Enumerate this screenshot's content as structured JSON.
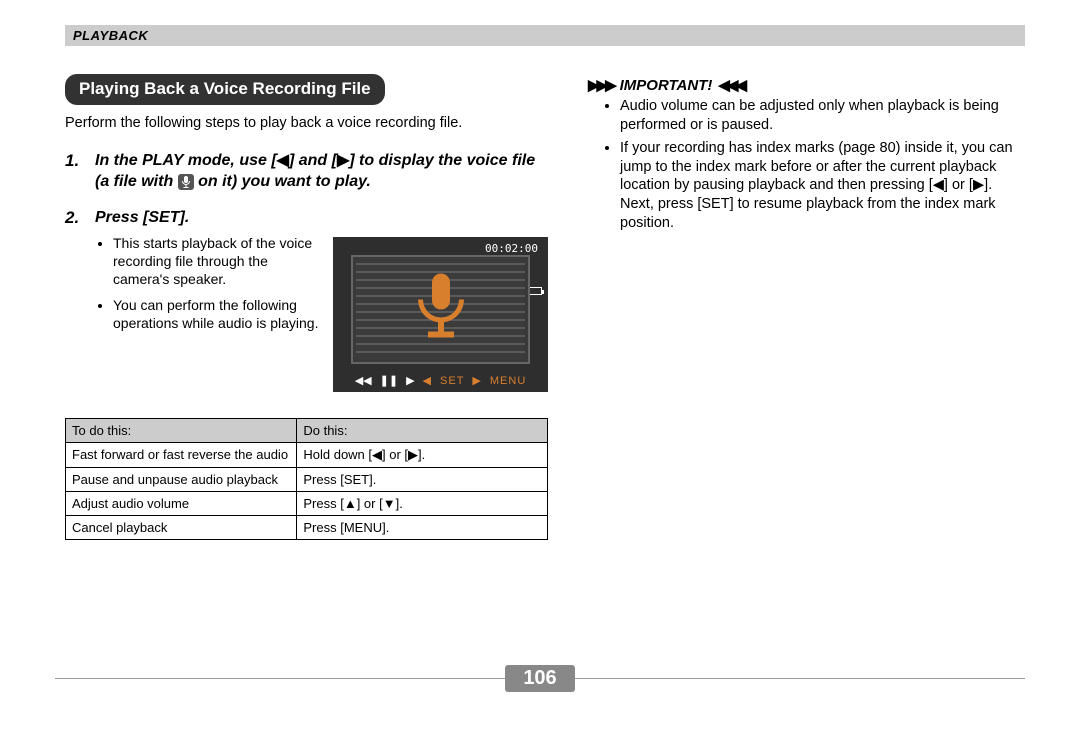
{
  "header": {
    "section": "PLAYBACK"
  },
  "left": {
    "title": "Playing Back a Voice Recording File",
    "intro": "Perform the following steps to play back a voice recording file.",
    "step1_a": "In the PLAY mode, use [",
    "step1_b": "] and [",
    "step1_c": "] to display the voice file (a file with ",
    "step1_d": " on it) you want to play.",
    "step2": "Press [SET].",
    "sub1": "This starts playback of the voice recording file through the camera's speaker.",
    "sub2": "You can perform the following operations while audio is playing.",
    "screen_time": "00:02:00",
    "set_label": "SET",
    "menu_label": "MENU",
    "table": {
      "h1": "To do this:",
      "h2": "Do this:",
      "rows": [
        {
          "a": "Fast forward or fast reverse the audio",
          "b_pre": "Hold down [",
          "b_mid": "] or [",
          "b_post": "]."
        },
        {
          "a": "Pause and unpause audio playback",
          "b_plain": "Press [SET]."
        },
        {
          "a": "Adjust audio volume",
          "b_pre": "Press [",
          "b_mid": "] or [",
          "b_post": "].",
          "ud": true
        },
        {
          "a": "Cancel playback",
          "b_plain": "Press [MENU]."
        }
      ]
    }
  },
  "right": {
    "heading": "IMPORTANT!",
    "b1": "Audio volume can be adjusted only when playback is being performed or is paused.",
    "b2_a": "If your recording has index marks (page 80) inside it, you can jump to the index mark before or after the current playback location by pausing playback and then pressing [",
    "b2_b": "] or [",
    "b2_c": "]. Next, press [SET] to resume playback from the index mark position."
  },
  "glyph": {
    "left": "◀",
    "right": "▶",
    "up": "▲",
    "down": "▼",
    "dright": "▶▶▶",
    "dleft": "◀◀◀",
    "rew": "◀◀",
    "pause": "❚❚"
  },
  "page": "106"
}
